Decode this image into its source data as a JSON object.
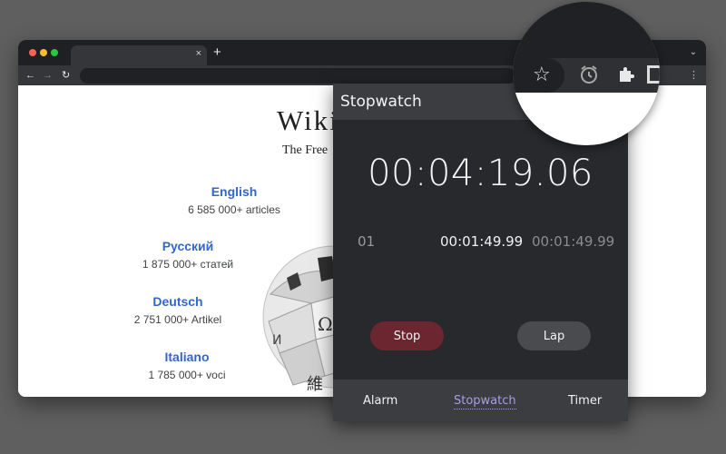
{
  "browser": {
    "tab_close": "×",
    "new_tab": "+",
    "tabstrip_menu": "⌄",
    "nav_back": "←",
    "nav_forward": "→",
    "nav_reload": "↻",
    "menu": "⋮"
  },
  "wikipedia": {
    "title": "Wiki",
    "tagline": "The Free",
    "languages": [
      {
        "name": "English",
        "count": "6 585 000+ articles"
      },
      {
        "name": "Русский",
        "count": "1 875 000+ статей"
      },
      {
        "name": "Deutsch",
        "count": "2 751 000+ Artikel"
      },
      {
        "name": "Italiano",
        "count": "1 785 000+ voci"
      }
    ],
    "link_color": "#3366cc"
  },
  "stopwatch": {
    "title": "Stopwatch",
    "time": "00:04:19.06",
    "laps": [
      {
        "index": "01",
        "lap_time": "00:01:49.99",
        "total": "00:01:49.99"
      }
    ],
    "buttons": {
      "stop": "Stop",
      "lap": "Lap"
    },
    "nav": {
      "alarm": "Alarm",
      "stopwatch": "Stopwatch",
      "timer": "Timer"
    },
    "active_nav": "stopwatch",
    "colors": {
      "stop": "#6c2630",
      "lap": "#4a4b4e",
      "accent": "#a99be8",
      "panel": "#27292c"
    }
  },
  "magnifier": {
    "icons": [
      "star-icon",
      "alarm-clock-icon",
      "puzzle-icon",
      "side-panel-icon",
      "extension-badge-icon",
      "menu-icon"
    ],
    "menu": "⋮"
  }
}
